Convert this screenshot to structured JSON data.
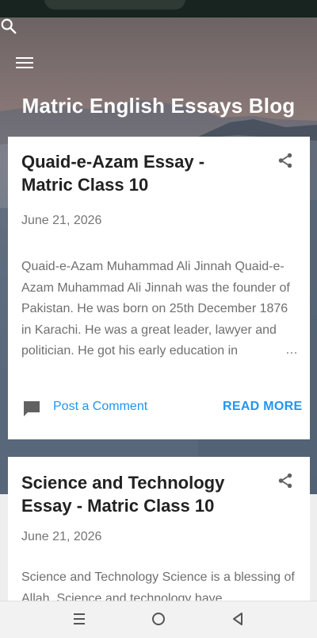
{
  "header": {
    "blog_title": "Matric English Essays Blog",
    "menu_icon": "hamburger-menu-icon",
    "search_icon": "search-icon"
  },
  "posts": [
    {
      "title": "Quaid-e-Azam Essay - Matric Class 10",
      "date": "June 21, 2026",
      "snippet": " Quaid-e-Azam Muhammad Ali Jinnah Quaid-e-Azam Muhammad Ali Jinnah was the founder of Pakistan. He was born on 25th December 1876 in Karachi. He was a great leader, lawyer and politician. He got his early education in",
      "ellipsis": "…",
      "comment_label": "Post a Comment",
      "read_more_label": "READ MORE"
    },
    {
      "title": "Science and Technology Essay - Matric Class 10",
      "date": "June 21, 2026",
      "snippet": " Science and Technology Science is a blessing of Allah. Science and technology have"
    }
  ],
  "colors": {
    "accent": "#2196f3",
    "title_text": "#212121",
    "muted_text": "#757575"
  }
}
